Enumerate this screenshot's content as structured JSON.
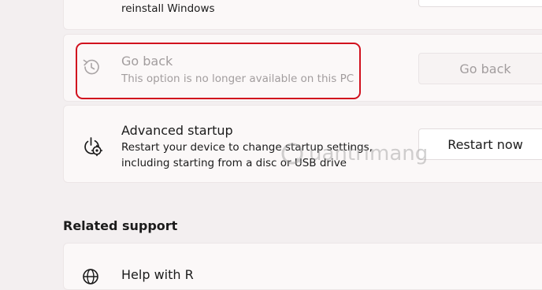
{
  "reset_card": {
    "desc_line2": "reinstall Windows"
  },
  "go_back": {
    "title": "Go back",
    "description": "This option is no longer available on this PC",
    "button_label": "Go back",
    "icon": "history-icon"
  },
  "advanced_startup": {
    "title": "Advanced startup",
    "description_line1": "Restart your device to change startup settings,",
    "description_line2": "including starting from a disc or USB drive",
    "button_label": "Restart now",
    "icon": "power-gear-icon"
  },
  "related_support": {
    "section_title": "Related support",
    "items": [
      {
        "label": "Help with R",
        "icon": "globe-icon"
      }
    ]
  },
  "watermark": {
    "text": "uantrimang",
    "icon": "watermark-logo"
  },
  "colors": {
    "highlight": "#d1111e",
    "disabled_text": "#a29d9e"
  }
}
